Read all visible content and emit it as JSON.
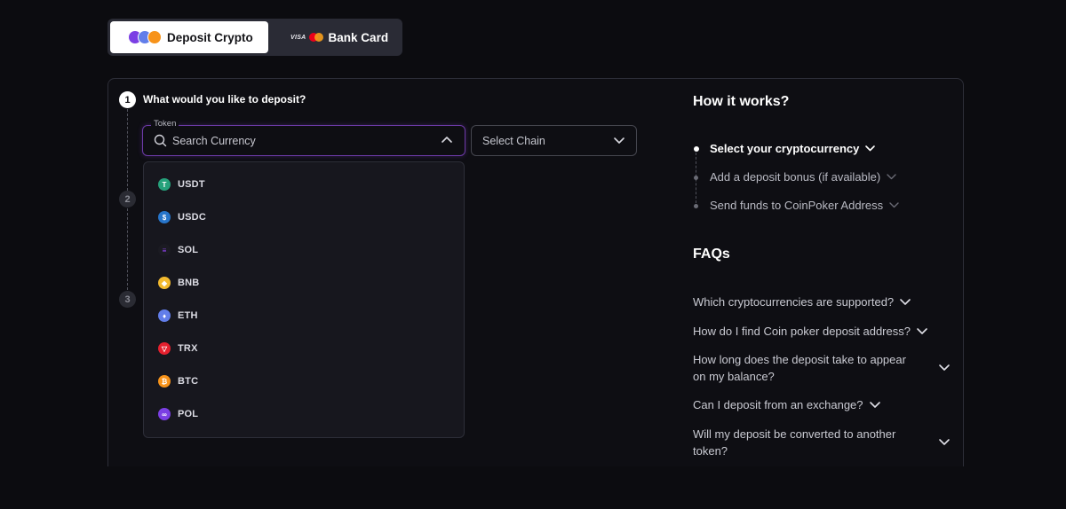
{
  "tabs": {
    "crypto_label": "Deposit Crypto",
    "card_label": "Bank Card",
    "card_brand_text": "VISA",
    "active": "crypto"
  },
  "steps": {
    "step1_number": "1",
    "step1_title": "What would you like to deposit?",
    "step2_number": "2",
    "step3_number": "3"
  },
  "token": {
    "legend": "Token",
    "placeholder": "Search Currency",
    "value": ""
  },
  "chain": {
    "label": "Select Chain"
  },
  "currencies": [
    {
      "label": "USDT",
      "icon": "usdt-icon",
      "glyph": "T",
      "color": "#26a17b"
    },
    {
      "label": "USDC",
      "icon": "usdc-icon",
      "glyph": "$",
      "color": "#2775ca"
    },
    {
      "label": "SOL",
      "icon": "sol-icon",
      "glyph": "≡",
      "color": "#1b1b22"
    },
    {
      "label": "BNB",
      "icon": "bnb-icon",
      "glyph": "◆",
      "color": "#f3ba2f"
    },
    {
      "label": "ETH",
      "icon": "eth-icon",
      "glyph": "♦",
      "color": "#627eea"
    },
    {
      "label": "TRX",
      "icon": "trx-icon",
      "glyph": "▽",
      "color": "#e5202e"
    },
    {
      "label": "BTC",
      "icon": "btc-icon",
      "glyph": "₿",
      "color": "#f7931a"
    },
    {
      "label": "POL",
      "icon": "pol-icon",
      "glyph": "∞",
      "color": "#7b3fe4"
    }
  ],
  "how_it_works": {
    "title": "How it works?",
    "items": [
      {
        "label": "Select your cryptocurrency"
      },
      {
        "label": "Add a deposit bonus (if available)"
      },
      {
        "label": "Send funds to CoinPoker Address"
      }
    ]
  },
  "faqs": {
    "title": "FAQs",
    "items": [
      {
        "line1": "Which cryptocurrencies are supported?",
        "line2": ""
      },
      {
        "line1": "How do I find Coin poker deposit address?",
        "line2": ""
      },
      {
        "line1": "How long does the deposit take to appear",
        "line2": "on my balance?"
      },
      {
        "line1": "Can I deposit from an exchange?",
        "line2": ""
      },
      {
        "line1": "Will my deposit be converted to another",
        "line2": "token?"
      }
    ]
  },
  "colors": {
    "background": "#0c0c10",
    "accent_purple": "#6d3aa8",
    "tab_active_bg": "#ffffff",
    "tab_bar_bg": "#2a2b35"
  }
}
